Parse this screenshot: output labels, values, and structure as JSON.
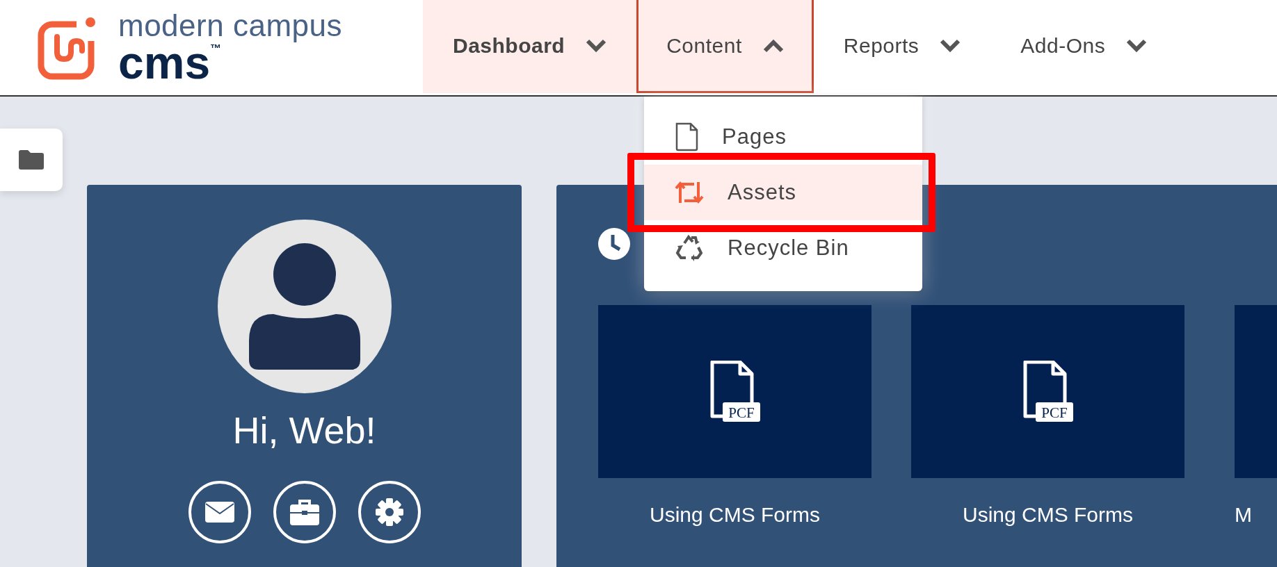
{
  "logo": {
    "line1": "modern campus",
    "line2": "cms$^{™}$"
  },
  "nav": [
    {
      "label": "Dashboard",
      "current": true,
      "open": false
    },
    {
      "label": "Content",
      "current": false,
      "open": true
    },
    {
      "label": "Reports",
      "current": false,
      "open": false
    },
    {
      "label": "Add-Ons",
      "current": false,
      "open": false
    }
  ],
  "dropdown": {
    "items": [
      {
        "label": "Pages",
        "kind": "page",
        "selected": false,
        "annotated": false
      },
      {
        "label": "Assets",
        "kind": "assets",
        "selected": true,
        "annotated": true
      },
      {
        "label": "Recycle Bin",
        "kind": "recycle",
        "selected": false,
        "annotated": false
      }
    ]
  },
  "profile": {
    "greeting": "Hi, Web!",
    "actions": [
      {
        "kind": "mail"
      },
      {
        "kind": "briefcase"
      },
      {
        "kind": "settings"
      }
    ]
  },
  "recent": {
    "tiles": [
      {
        "label": "Using CMS Forms",
        "badge": "PCF"
      },
      {
        "label": "Using CMS Forms",
        "badge": "PCF"
      },
      {
        "label": "M",
        "cut": true
      }
    ]
  }
}
